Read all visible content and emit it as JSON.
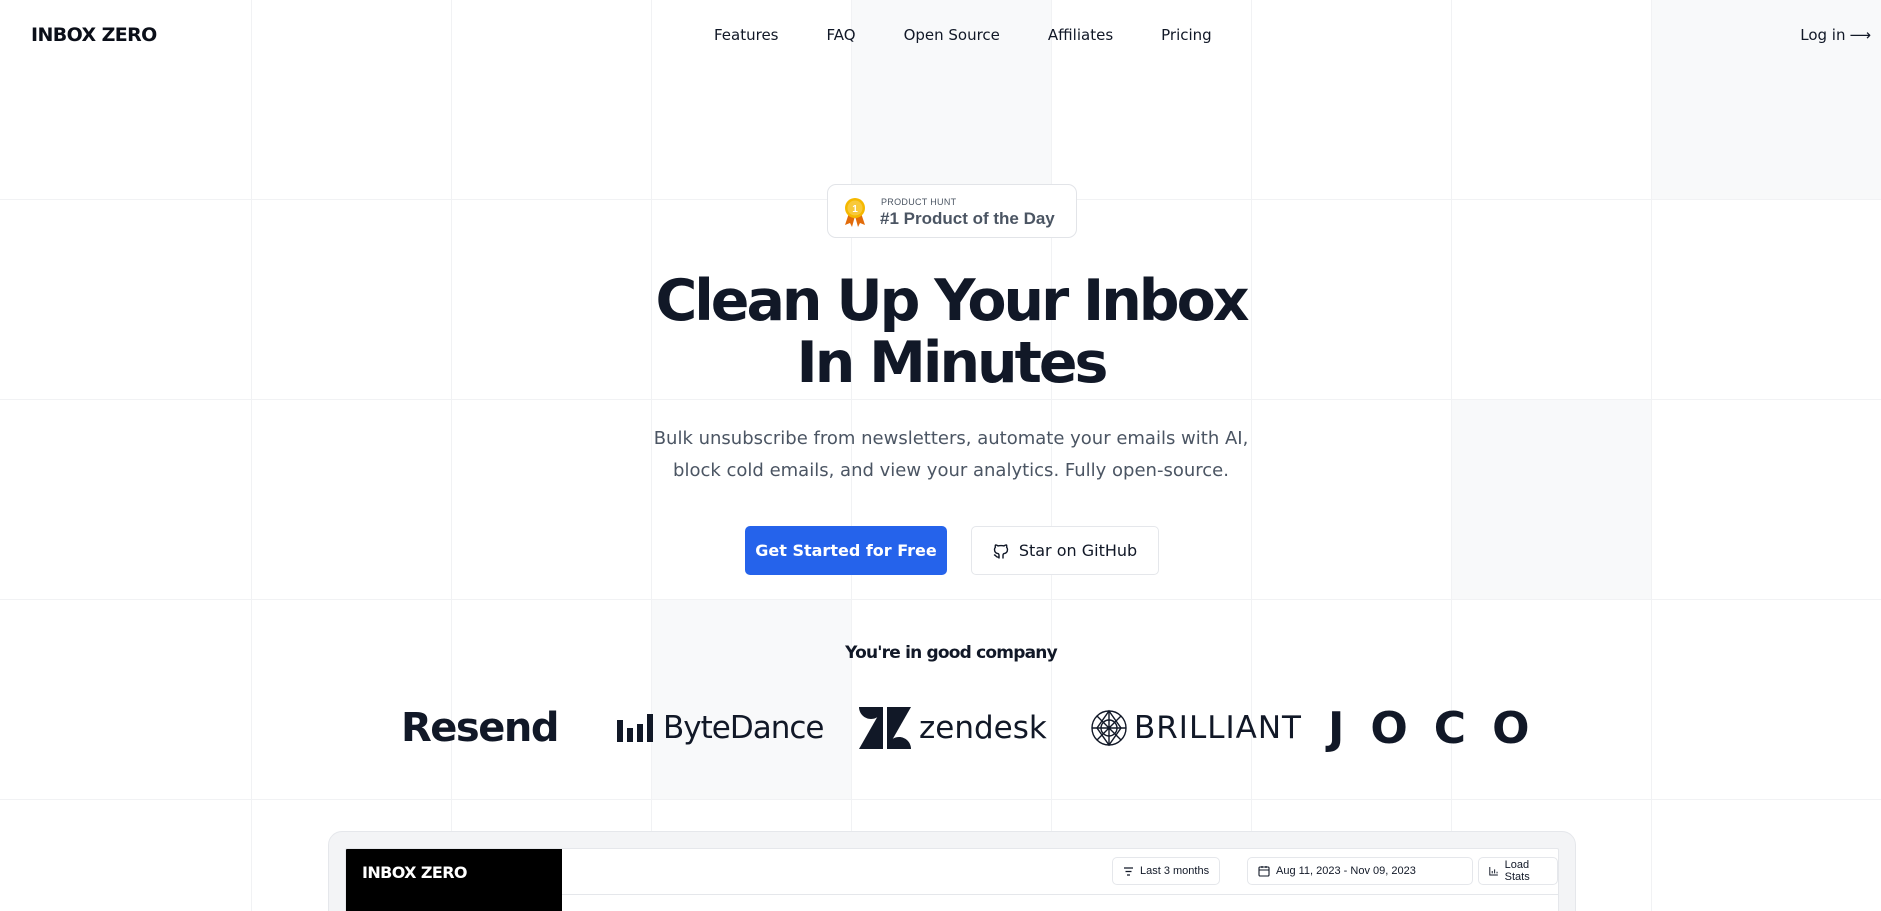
{
  "brand": {
    "name": "INBOX ZERO"
  },
  "nav": {
    "items": [
      "Features",
      "FAQ",
      "Open Source",
      "Affiliates",
      "Pricing"
    ],
    "login": "Log in",
    "login_arrow": "⟶"
  },
  "badge": {
    "kicker": "PRODUCT HUNT",
    "title": "#1 Product of the Day",
    "medal_number": "1"
  },
  "hero": {
    "title_line1": "Clean Up Your Inbox",
    "title_line2": "In Minutes",
    "subtitle_line1": "Bulk unsubscribe from newsletters, automate your emails with AI,",
    "subtitle_line2": "block cold emails, and view your analytics. Fully open-source."
  },
  "cta": {
    "primary": "Get Started for Free",
    "secondary": "Star on GitHub"
  },
  "social_proof": {
    "heading": "You're in good company",
    "logos": [
      "Resend",
      "ByteDance",
      "zendesk",
      "BRILLIANT",
      "JOCO"
    ]
  },
  "preview": {
    "logo": "INBOX ZERO",
    "range": "Last 3 months",
    "dates": "Aug 11, 2023 - Nov 09, 2023",
    "load": "Load Stats"
  },
  "colors": {
    "primary": "#2563eb",
    "text": "#111827",
    "muted": "#4b5563",
    "medal_gold": "#f5b800",
    "medal_ribbon": "#e26b0a"
  },
  "icons": [
    "medal-icon",
    "github-icon",
    "arrow-right-icon",
    "filter-icon",
    "calendar-icon",
    "bar-chart-icon"
  ]
}
